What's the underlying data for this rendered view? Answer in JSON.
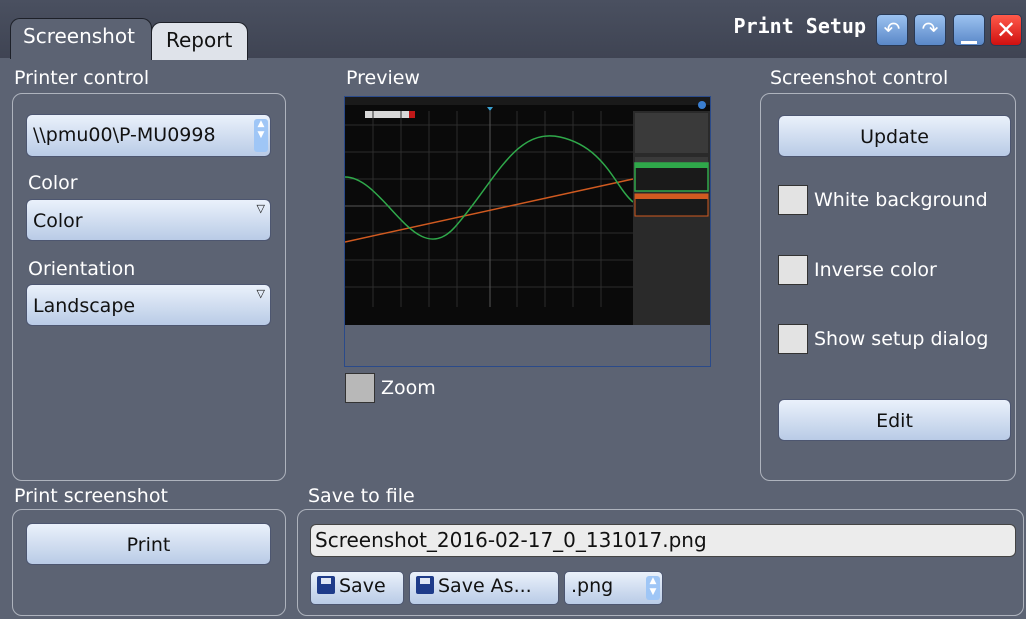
{
  "tabs": [
    {
      "label": "Screenshot",
      "active": true
    },
    {
      "label": "Report",
      "active": false
    }
  ],
  "window": {
    "title": "Print Setup",
    "buttons": [
      "undo-icon",
      "redo-icon",
      "minimize-icon",
      "close-icon"
    ]
  },
  "printer_control": {
    "heading": "Printer control",
    "printer": "\\\\pmu00\\P-MU0998",
    "color_label": "Color",
    "color_value": "Color",
    "orientation_label": "Orientation",
    "orientation_value": "Landscape"
  },
  "preview": {
    "heading": "Preview",
    "zoom_label": "Zoom",
    "zoom_checked": false
  },
  "screenshot_control": {
    "heading": "Screenshot control",
    "update_label": "Update",
    "white_background_label": "White background",
    "white_background_checked": false,
    "inverse_color_label": "Inverse color",
    "inverse_color_checked": false,
    "show_setup_dialog_label": "Show setup dialog",
    "show_setup_dialog_checked": false,
    "edit_label": "Edit"
  },
  "print_screenshot": {
    "heading": "Print screenshot",
    "print_label": "Print"
  },
  "save_to_file": {
    "heading": "Save to file",
    "filename": "Screenshot_2016-02-17_0_131017.png",
    "save_label": "Save",
    "save_as_label": "Save As...",
    "format": ".png"
  },
  "colors": {
    "background": "#5c6373",
    "button_gradient_top": "#eaf1fb",
    "button_gradient_bottom": "#b9cbe6",
    "close_red": "#e01818",
    "title_button_blue": "#5a88c8",
    "preview_trace_green": "#2fa84a",
    "preview_trace_orange": "#d05a20"
  }
}
